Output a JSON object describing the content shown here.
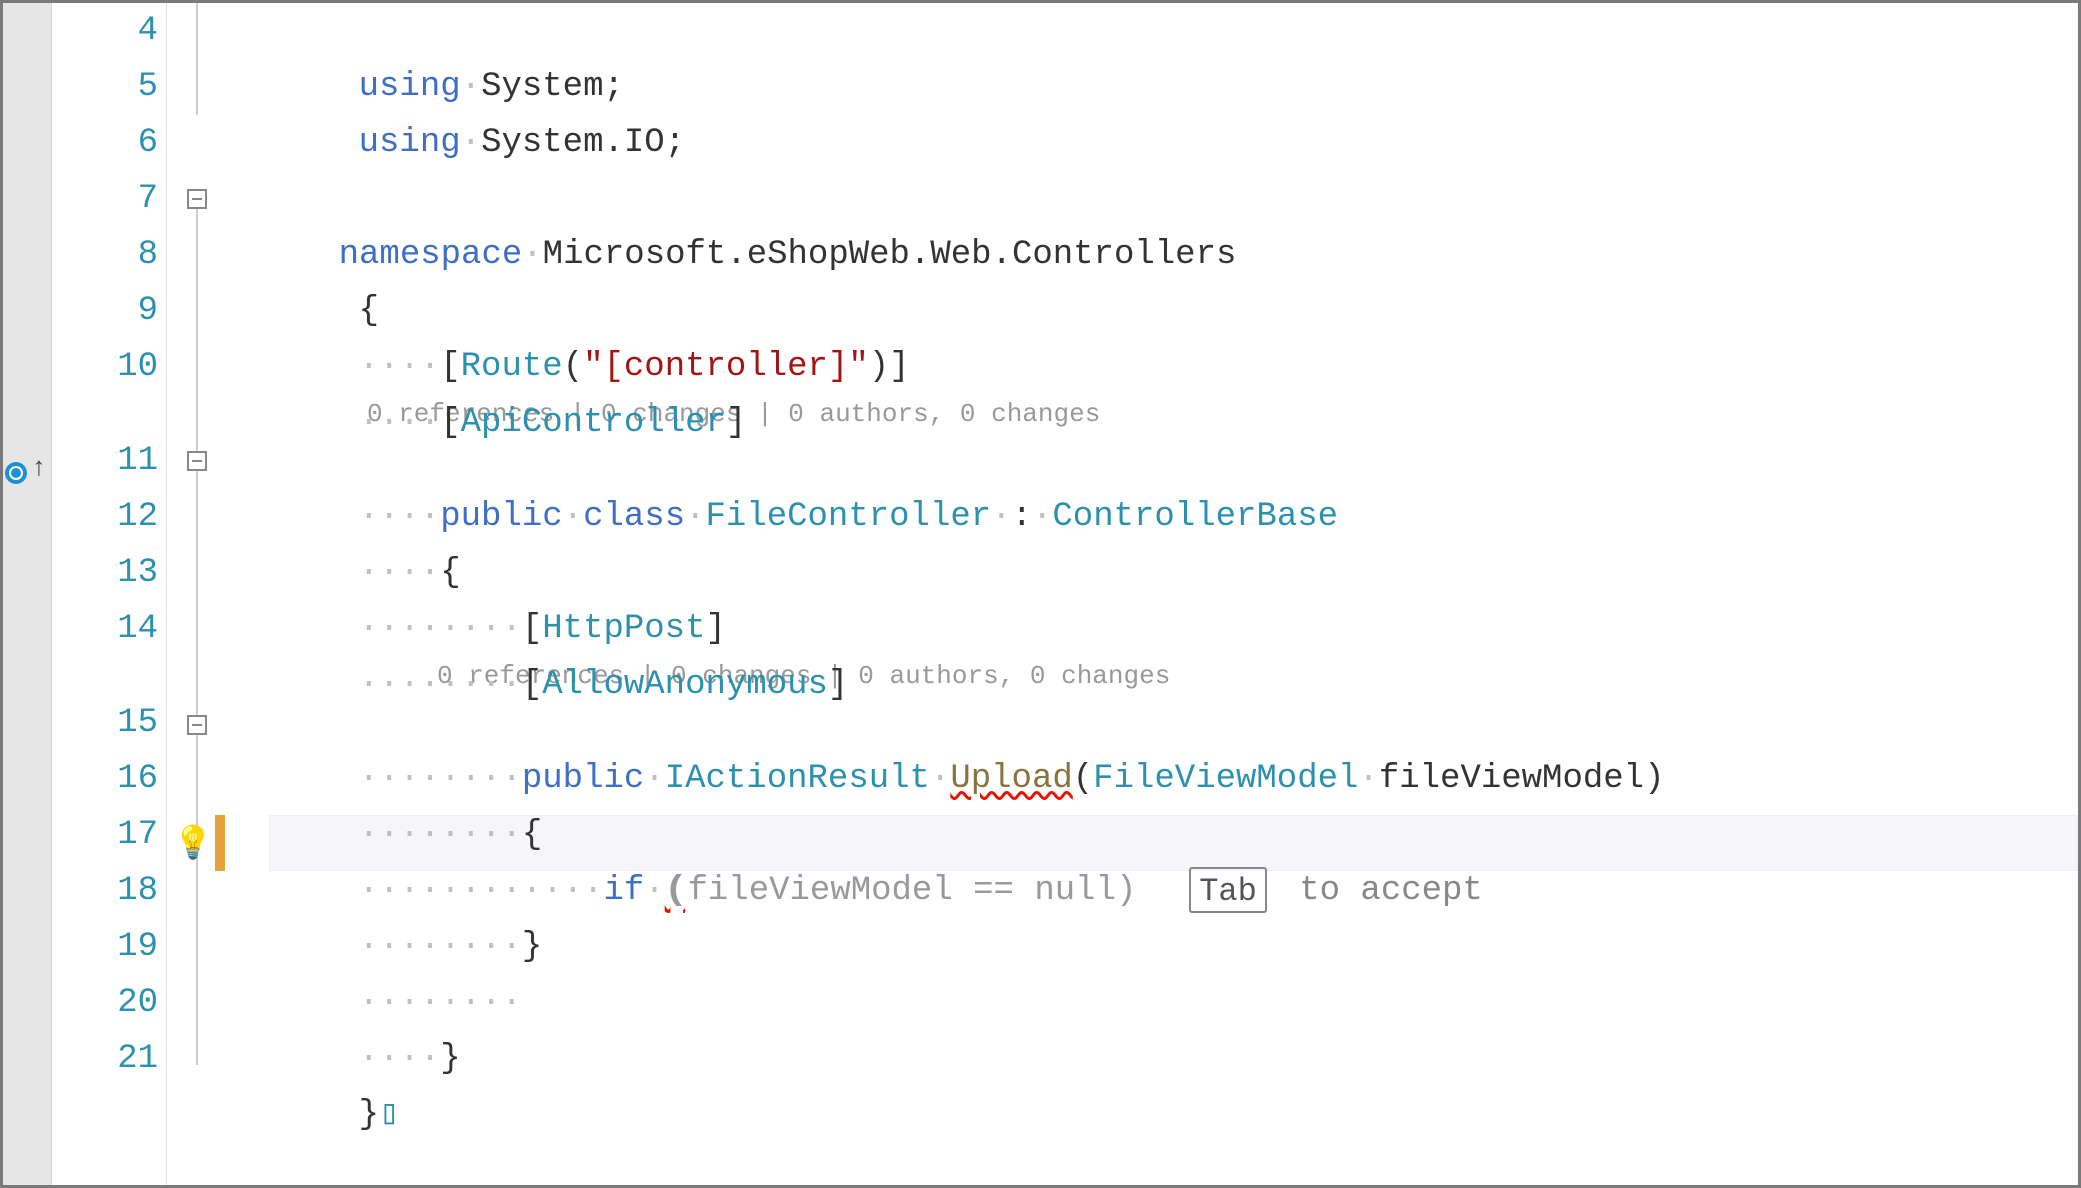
{
  "lines": {
    "4": {
      "using": "using",
      "sep": "·",
      "ns": "System",
      "semi": ";"
    },
    "5": {
      "using": "using",
      "sep": "·",
      "ns": "System.IO",
      "semi": ";"
    },
    "7": {
      "ws": "",
      "namespace": "namespace",
      "sep": "·",
      "name": "Microsoft.eShopWeb.Web.Controllers"
    },
    "8": {
      "brace": "{"
    },
    "9": {
      "ws": "····",
      "lb": "[",
      "attr": "Route",
      "lp": "(",
      "str": "\"[controller]\"",
      "rp": ")",
      "rb": "]"
    },
    "10": {
      "ws": "····",
      "lb": "[",
      "attr": "ApiController",
      "rb": "]"
    },
    "codelens1": "0 references | 0 changes | 0 authors, 0 changes",
    "11": {
      "ws": "····",
      "public": "public",
      "s1": "·",
      "class": "class",
      "s2": "·",
      "name": "FileController",
      "s3": "·",
      "colon": ":",
      "s4": "·",
      "base": "ControllerBase"
    },
    "12": {
      "ws": "····",
      "brace": "{"
    },
    "13": {
      "ws": "········",
      "lb": "[",
      "attr": "HttpPost",
      "rb": "]"
    },
    "14": {
      "ws": "········",
      "lb": "[",
      "attr": "AllowAnonymous",
      "rb": "]"
    },
    "codelens2": "0 references | 0 changes | 0 authors, 0 changes",
    "15": {
      "ws": "········",
      "public": "public",
      "s1": "·",
      "ret": "IActionResult",
      "s2": "·",
      "method": "Upload",
      "lp": "(",
      "ptype": "FileViewModel",
      "s3": "·",
      "pname": "fileViewModel",
      "rp": ")"
    },
    "16": {
      "ws": "········",
      "brace": "{"
    },
    "17": {
      "ws": "············",
      "if": "if",
      "s1": "·",
      "ghost": "(fileViewModel == null)",
      "ghostlp": "(",
      "tabkey": "Tab",
      "accept": " to accept"
    },
    "18": {
      "ws": "········",
      "brace": "}"
    },
    "19": {
      "ws": "········"
    },
    "20": {
      "ws": "····",
      "brace": "}"
    },
    "21": {
      "brace": "}",
      "cursor": "▯"
    }
  },
  "numbers": [
    "4",
    "5",
    "6",
    "7",
    "8",
    "9",
    "10",
    "",
    "11",
    "12",
    "13",
    "14",
    "",
    "15",
    "16",
    "17",
    "18",
    "19",
    "20",
    "21"
  ],
  "icons": {
    "lightbulb": "💡"
  },
  "colors": {
    "keyword": "#3f6ec6",
    "type": "#2b91af",
    "method": "#8b7340",
    "string": "#a31515",
    "ghost": "#999999"
  }
}
